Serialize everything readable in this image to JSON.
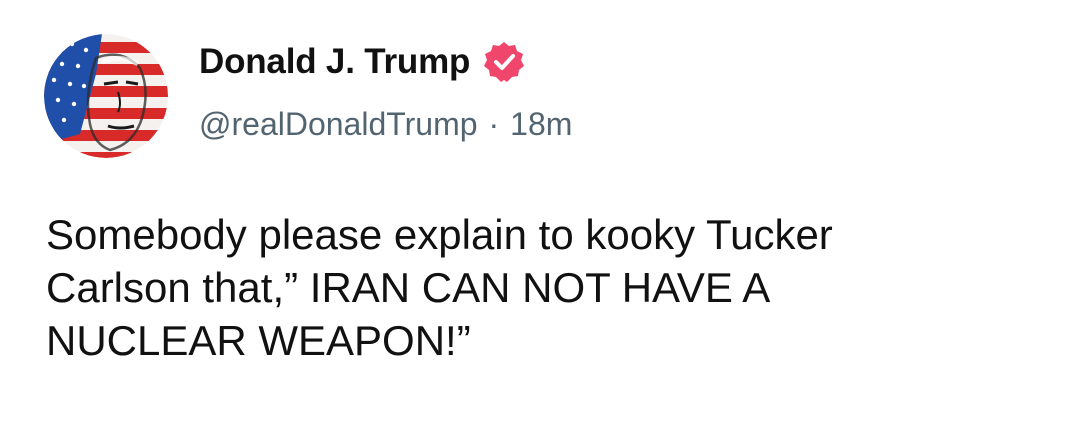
{
  "author": {
    "display_name": "Donald J. Trump",
    "handle": "@realDonaldTrump",
    "verified_icon": "verified-badge-icon",
    "avatar_icon": "flag-portrait-avatar"
  },
  "post": {
    "separator": "·",
    "timestamp": "18m",
    "text": "Somebody please explain to kooky Tucker\nCarlson that,” IRAN CAN NOT HAVE A\nNUCLEAR WEAPON!”"
  },
  "colors": {
    "verified": "#f0466b",
    "secondary_text": "#536471",
    "primary_text": "#111111",
    "flag_red": "#d92a2a",
    "flag_blue": "#1f4fa8"
  }
}
